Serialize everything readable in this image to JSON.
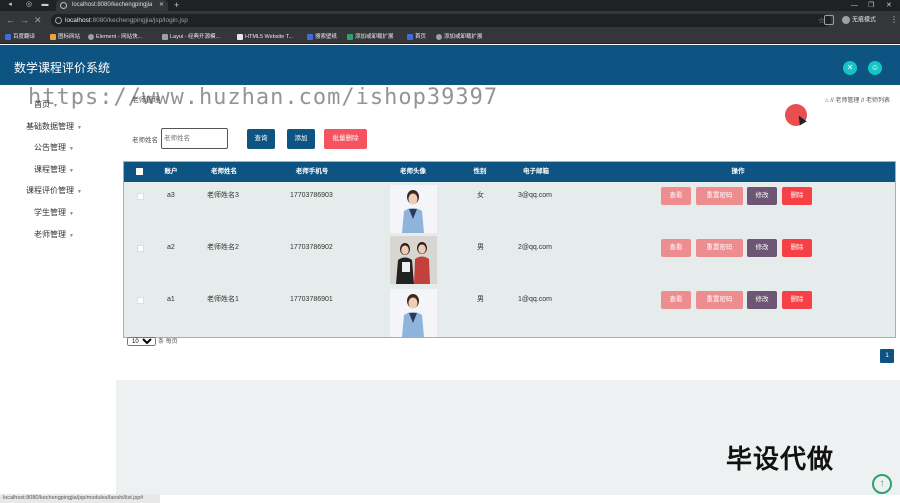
{
  "browser": {
    "tab_title": "localhost:8080/kechengpingjia",
    "url_host": "localhost",
    "url_path": ":8080/kechengpingjia/jsp/login.jsp",
    "profile_label": "无痕模式",
    "bookmarks": [
      "百度翻译",
      "图标网站",
      "Element - 网站快...",
      "Layui - 经典开源模...",
      "HTML5 Website T...",
      "搜索壁纸",
      "添加或卸载扩展",
      "首页",
      "添加或卸载扩展"
    ],
    "status_url": "localhost:8080/kechengpingjia/jsp/modules/laoshi/list.jsp#"
  },
  "header": {
    "title": "数学课程评价系统"
  },
  "sidebar": {
    "items": [
      {
        "label": "首页",
        "caret": "▼"
      },
      {
        "label": "基础数据管理",
        "caret": "▼"
      },
      {
        "label": "公告管理",
        "caret": "▼"
      },
      {
        "label": "课程管理",
        "caret": "▼"
      },
      {
        "label": "课程评价管理",
        "caret": "▼"
      },
      {
        "label": "学生管理",
        "caret": "▼"
      },
      {
        "label": "老师管理",
        "caret": "▼"
      }
    ]
  },
  "page": {
    "title": "老师管理",
    "breadcrumb": "⌂ // 老师管理 // 老师列表",
    "search_label": "老师姓名",
    "search_placeholder": "老师姓名",
    "query_button": "查询",
    "add_button": "添加",
    "batch_delete_button": "批量删除"
  },
  "table": {
    "headers": [
      "账户",
      "老师姓名",
      "老师手机号",
      "老师头像",
      "性别",
      "电子邮箱",
      "操作"
    ],
    "rows": [
      {
        "account": "a3",
        "name": "老师姓名3",
        "phone": "17703786903",
        "gender": "女",
        "email": "3@qq.com"
      },
      {
        "account": "a2",
        "name": "老师姓名2",
        "phone": "17703786902",
        "gender": "男",
        "email": "2@qq.com"
      },
      {
        "account": "a1",
        "name": "老师姓名1",
        "phone": "17703786901",
        "gender": "男",
        "email": "1@qq.com"
      }
    ],
    "actions": {
      "view": "查看",
      "reset": "重置密码",
      "edit": "修改",
      "delete": "删除"
    }
  },
  "pager": {
    "page_size": "10",
    "per_page_label": "条 每页",
    "current_page": "1"
  },
  "watermarks": {
    "url": "https://www.huzhan.com/ishop39397",
    "corner": "毕设代做"
  }
}
